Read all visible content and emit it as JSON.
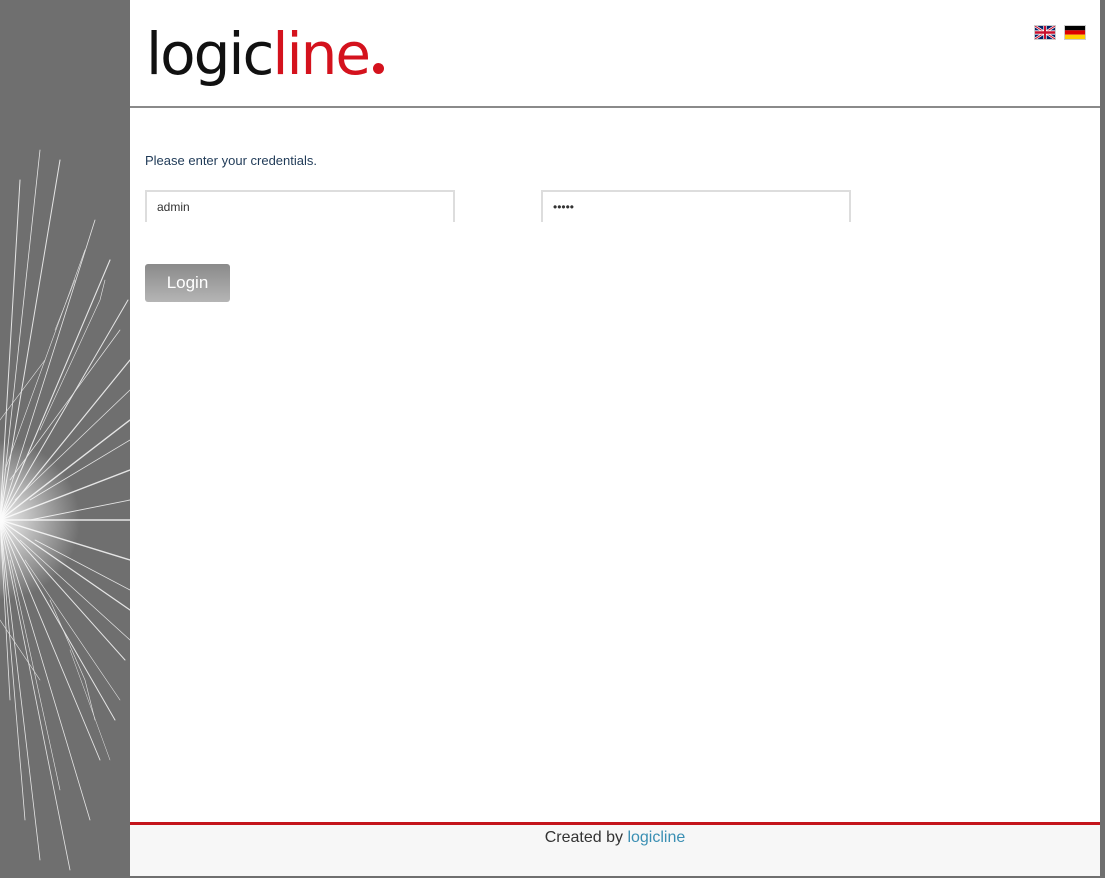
{
  "brand": {
    "logo_dark": "logic",
    "logo_red": "line",
    "red_color": "#d4121d"
  },
  "language": {
    "flags": [
      {
        "name": "english",
        "icon": "uk-flag-icon"
      },
      {
        "name": "german",
        "icon": "germany-flag-icon"
      }
    ]
  },
  "login": {
    "prompt": "Please enter your credentials.",
    "username_value": "admin",
    "password_value": "•••••",
    "button_label": "Login"
  },
  "footer": {
    "created_by": "Created by",
    "link_label": "logicline",
    "border_color": "#c4141b",
    "link_color": "#3a8fb3"
  }
}
